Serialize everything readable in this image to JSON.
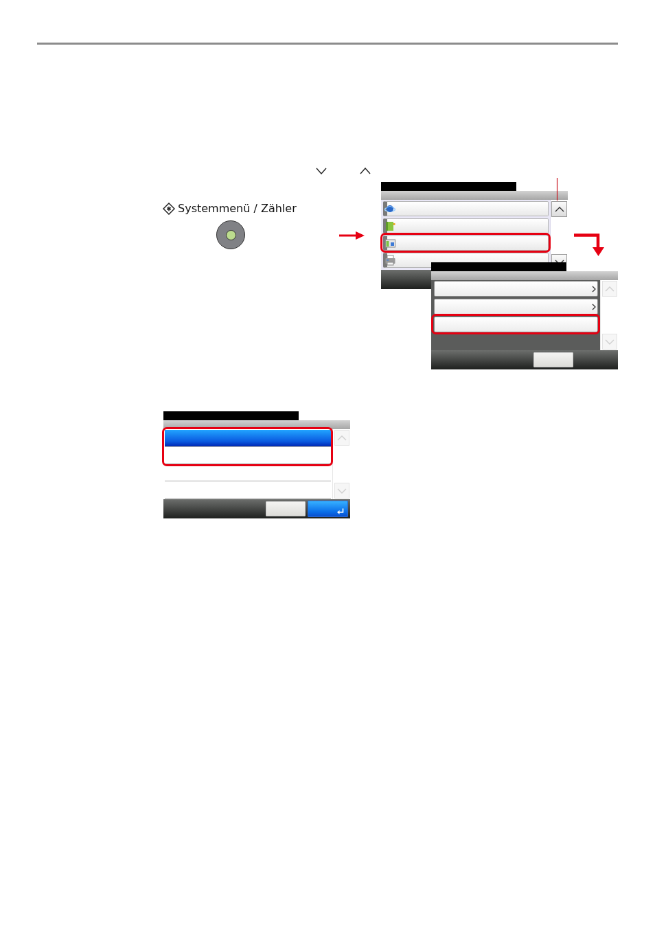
{
  "system_key": {
    "label": "Systemmenü / Zähler"
  },
  "screens": [
    {
      "kind": "menu",
      "rows": [
        {
          "framed": false
        },
        {
          "framed": false
        },
        {
          "framed": true
        },
        {
          "framed": false
        }
      ],
      "scroll": {
        "disabled": false
      }
    },
    {
      "kind": "submenu",
      "rows": [
        {
          "submenu": true,
          "framed": false
        },
        {
          "submenu": true,
          "framed": false
        },
        {
          "submenu": false,
          "framed": true
        }
      ],
      "scroll": {
        "disabled": true
      },
      "buttons": [
        {
          "kind": "plain"
        }
      ]
    },
    {
      "kind": "select",
      "rows": [
        {
          "selected": true,
          "framed": true
        },
        {
          "selected": false,
          "framed": true
        },
        {
          "selected": false,
          "framed": false
        },
        {
          "selected": false,
          "framed": false
        }
      ],
      "scroll": {
        "disabled": true
      },
      "buttons": [
        {
          "kind": "plain"
        },
        {
          "kind": "confirm"
        }
      ]
    }
  ]
}
